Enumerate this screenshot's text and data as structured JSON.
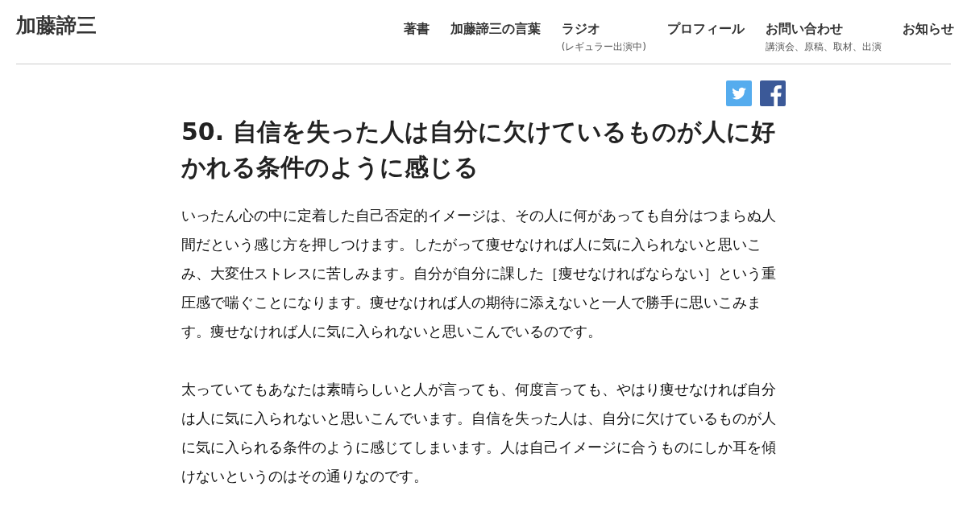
{
  "site_title": "加藤諦三",
  "nav": [
    {
      "label": "著書"
    },
    {
      "label": "加藤諦三の言葉"
    },
    {
      "label": "ラジオ",
      "sub": "(レギュラー出演中)"
    },
    {
      "label": "プロフィール"
    },
    {
      "label": "お問い合わせ",
      "sub": "講演会、原稿、取材、出演"
    },
    {
      "label": "お知らせ"
    }
  ],
  "share": [
    {
      "kind": "twitter"
    },
    {
      "kind": "facebook"
    }
  ],
  "article": {
    "title": "50. 自信を失った人は自分に欠けているものが人に好かれる条件のように感じる",
    "paragraphs": [
      "いったん心の中に定着した自己否定的イメージは、その人に何があっても自分はつまらぬ人間だという感じ方を押しつけます。したがって痩せなければ人に気に入られないと思いこみ、大変仕ストレスに苦しみます。自分が自分に課した［痩せなければならない］という重圧感で喘ぐことになります。痩せなければ人の期待に添えないと一人で勝手に思いこみます。痩せなければ人に気に入られないと思いこんでいるのです。",
      "太っていてもあなたは素晴らしいと人が言っても、何度言っても、やはり痩せなければ自分は人に気に入られないと思いこんでいます。自信を失った人は、自分に欠けているものが人に気に入られる条件のように感じてしまいます。人は自己イメージに合うものにしか耳を傾けないというのはその通りなのです。"
    ]
  }
}
